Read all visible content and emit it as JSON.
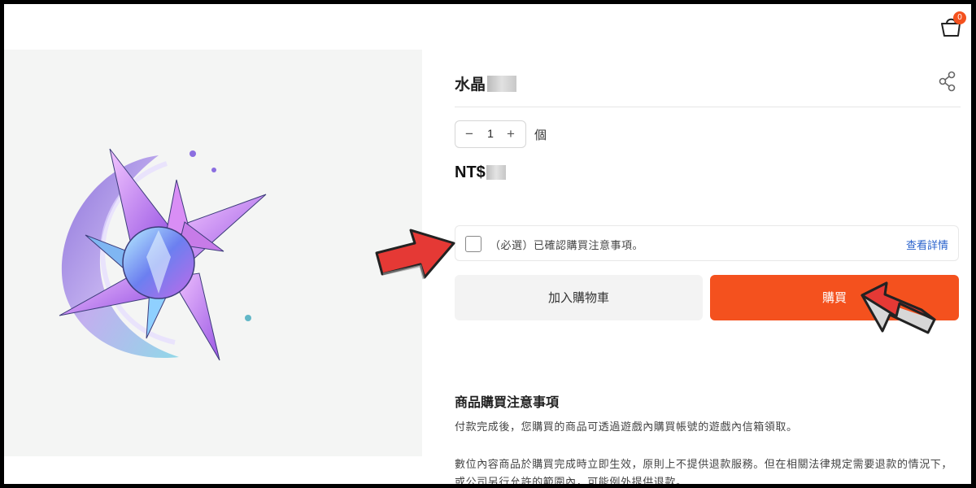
{
  "header": {
    "cart_count": "0",
    "cart_icon": "shopping-bag-icon"
  },
  "product": {
    "title": "水晶",
    "title_suffix_redacted": "",
    "share_icon": "share-icon",
    "quantity": "1",
    "minus_label": "−",
    "plus_label": "+",
    "unit": "個",
    "price_prefix": "NT$",
    "price_redacted": ""
  },
  "confirm": {
    "label": "（必選）已確認購買注意事項。",
    "details_link": "查看詳情"
  },
  "actions": {
    "add_to_cart": "加入購物車",
    "buy": "購買"
  },
  "notes": {
    "title": "商品購買注意事項",
    "paragraphs": [
      "付款完成後，您購買的商品可透過遊戲內購買帳號的遊戲內信箱領取。",
      "數位內容商品於購買完成時立即生效，原則上不提供退款服務。但在相關法律規定需要退款的情況下，或公司另行允許的範圍內，可能例外提供退款。"
    ]
  },
  "colors": {
    "accent": "#f4511e",
    "link": "#2962cc",
    "arrow_red": "#e53935"
  }
}
